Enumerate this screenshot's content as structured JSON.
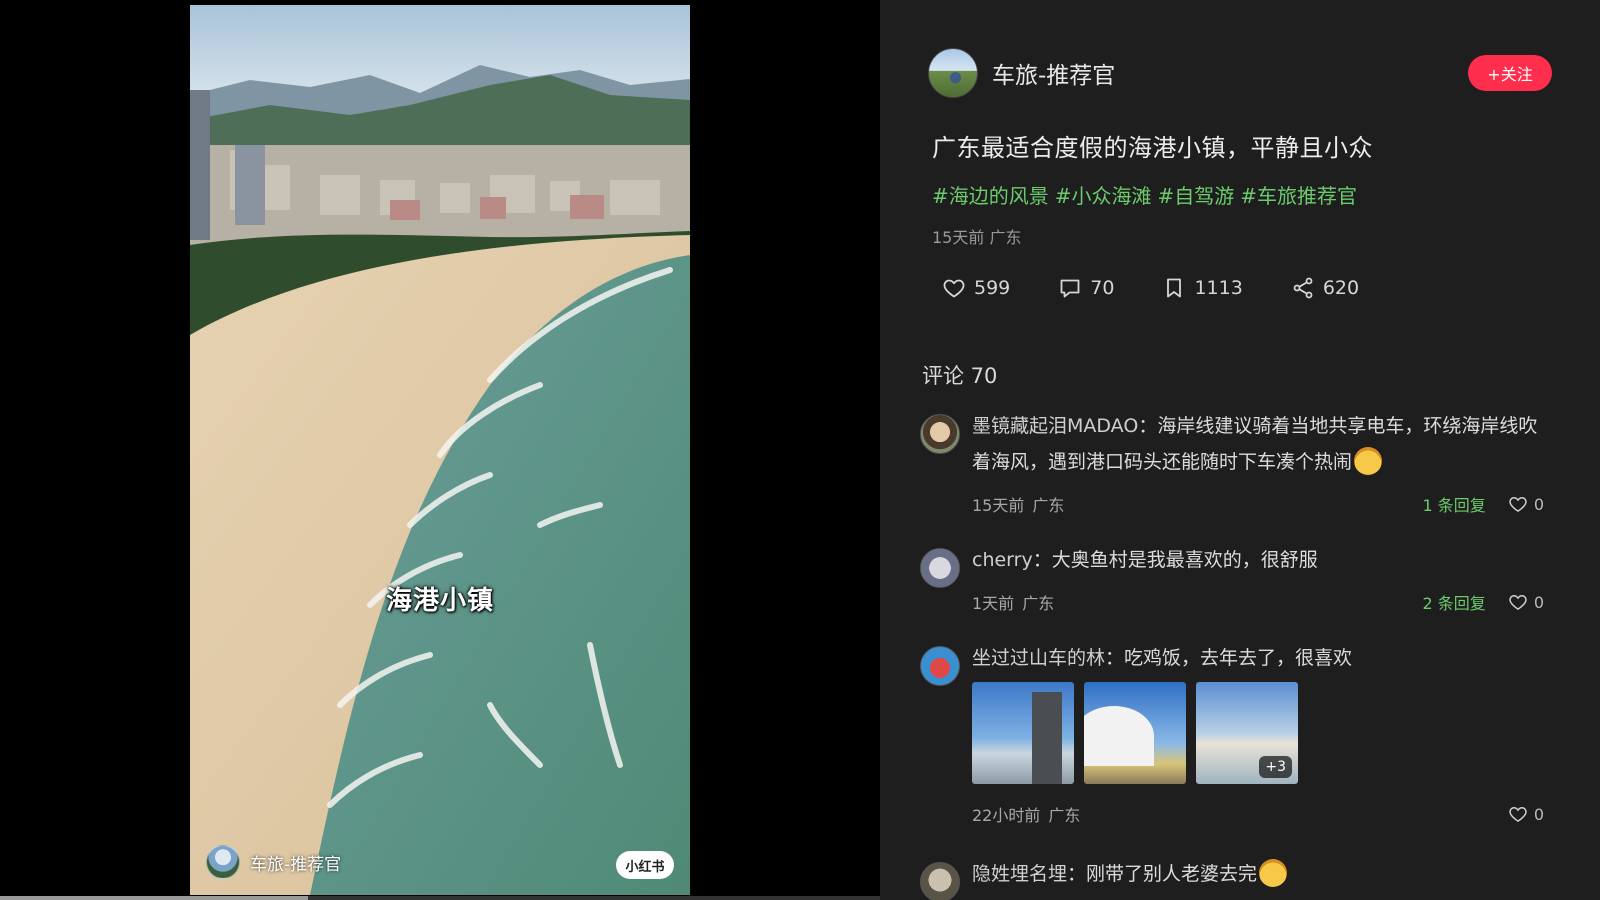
{
  "video": {
    "caption": "海港小镇",
    "author_name": "车旅-推荐官",
    "watermark": "小红书",
    "progress": 0.35
  },
  "author": {
    "name": "车旅-推荐官",
    "follow_label": "+关注"
  },
  "post": {
    "title": "广东最适合度假的海港小镇，平静且小众",
    "tags": [
      "#海边的风景",
      "#小众海滩",
      "#自驾游",
      "#车旅推荐官"
    ],
    "meta": "15天前  广东"
  },
  "stats": {
    "likes": "599",
    "comments": "70",
    "collects": "1113",
    "shares": "620"
  },
  "comments_header": "评论 70",
  "comments": [
    {
      "user": "墨镜藏起泪MADAO",
      "text": "：海岸线建议骑着当地共享电车，环绕海岸线吹着海风，遇到港口码头还能随时下车凑个热闹",
      "time": "15天前",
      "location": "广东",
      "replies": "1 条回复",
      "likes": "0"
    },
    {
      "user": "cherry",
      "text": "：大奥鱼村是我最喜欢的，很舒服",
      "time": "1天前",
      "location": "广东",
      "replies": "2 条回复",
      "likes": "0"
    },
    {
      "user": "坐过过山车的林",
      "text": "：吃鸡饭，去年去了，很喜欢",
      "time": "22小时前",
      "location": "广东",
      "more_images": "+3",
      "likes": "0"
    },
    {
      "user": "隐姓埋名埋",
      "text": "：刚带了别人老婆去完"
    }
  ],
  "colors": {
    "accent_red": "#ff2e4d",
    "tag_green": "#6ccb6c",
    "panel_bg": "#1e1e1e"
  }
}
